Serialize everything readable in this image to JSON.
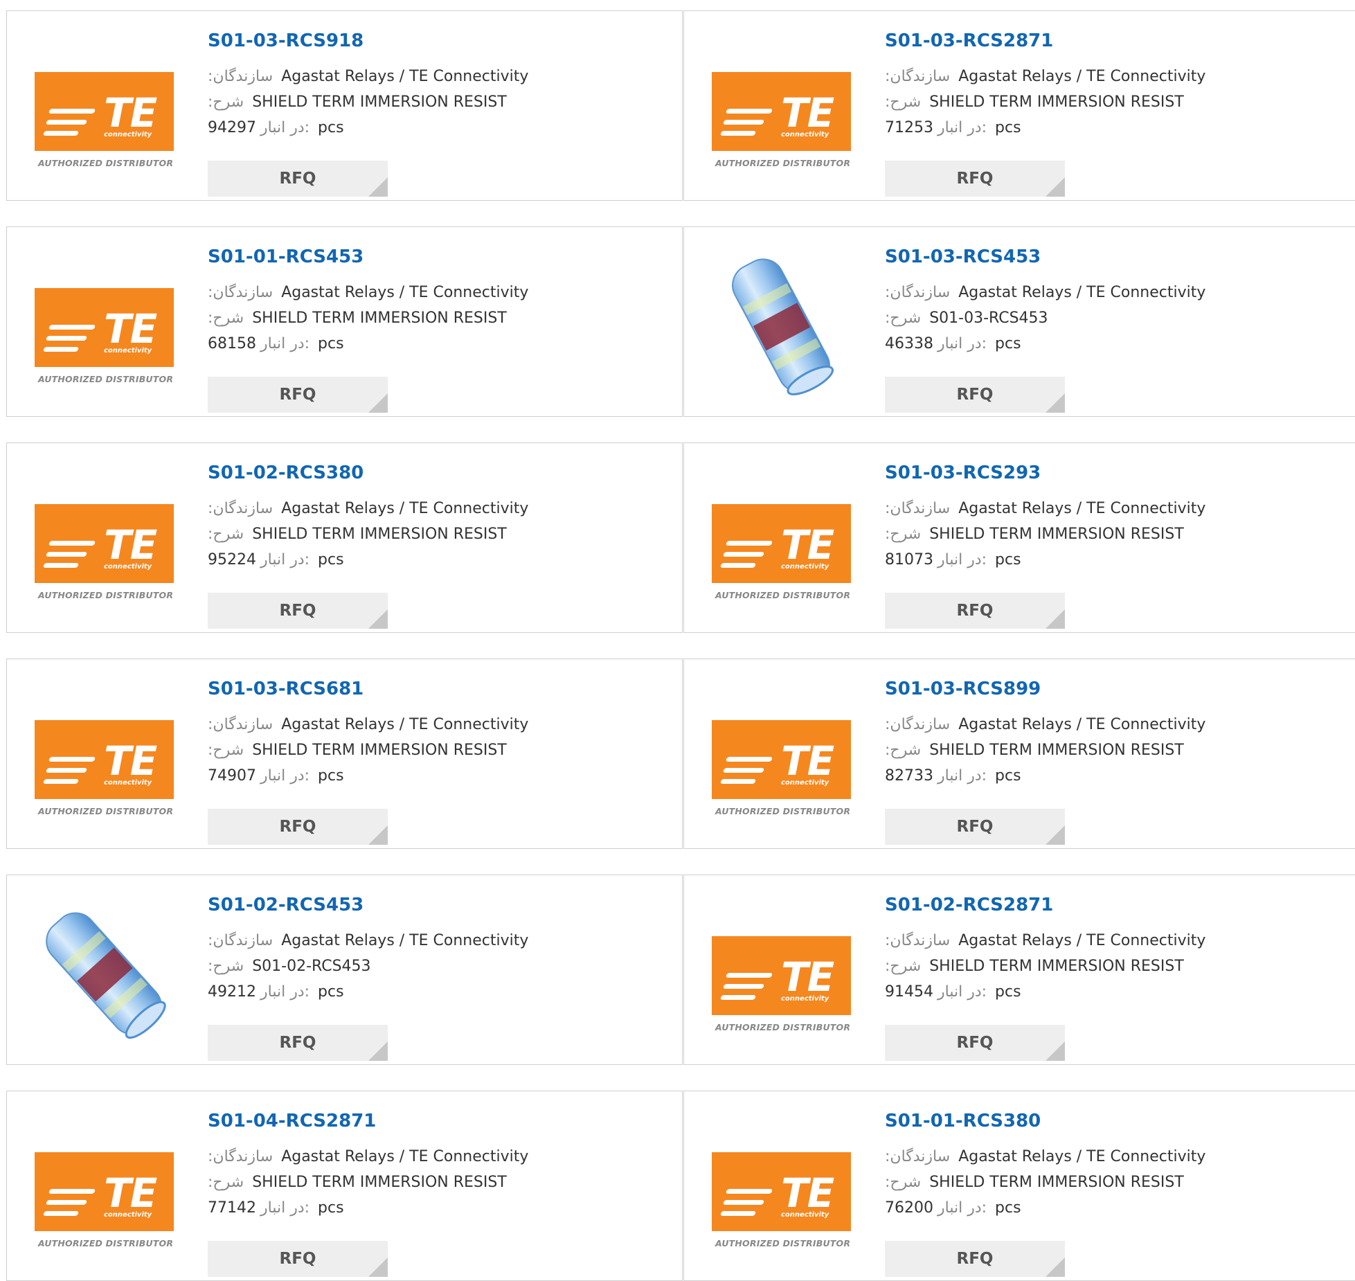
{
  "labels": {
    "manufacturer": ":سازندگان",
    "description": ":شرح",
    "stock": "در انبار:",
    "unit": "pcs",
    "rfq": "RFQ",
    "logo_brand": "TE",
    "logo_sub": "connectivity",
    "logo_caption": "AUTHORIZED DISTRIBUTOR"
  },
  "colors": {
    "brand_orange": "#f5871f",
    "link_blue": "#1166b3"
  },
  "products": [
    {
      "part": "S01-03-RCS918",
      "manufacturer": "Agastat Relays / TE Connectivity",
      "description": "SHIELD TERM IMMERSION RESIST",
      "stock": "94297",
      "image": "te-logo"
    },
    {
      "part": "S01-03-RCS2871",
      "manufacturer": "Agastat Relays / TE Connectivity",
      "description": "SHIELD TERM IMMERSION RESIST",
      "stock": "71253",
      "image": "te-logo"
    },
    {
      "part": "S01-01-RCS453",
      "manufacturer": "Agastat Relays / TE Connectivity",
      "description": "SHIELD TERM IMMERSION RESIST",
      "stock": "68158",
      "image": "te-logo"
    },
    {
      "part": "S01-03-RCS453",
      "manufacturer": "Agastat Relays / TE Connectivity",
      "description": "S01-03-RCS453",
      "stock": "46338",
      "image": "splice-photo"
    },
    {
      "part": "S01-02-RCS380",
      "manufacturer": "Agastat Relays / TE Connectivity",
      "description": "SHIELD TERM IMMERSION RESIST",
      "stock": "95224",
      "image": "te-logo"
    },
    {
      "part": "S01-03-RCS293",
      "manufacturer": "Agastat Relays / TE Connectivity",
      "description": "SHIELD TERM IMMERSION RESIST",
      "stock": "81073",
      "image": "te-logo"
    },
    {
      "part": "S01-03-RCS681",
      "manufacturer": "Agastat Relays / TE Connectivity",
      "description": "SHIELD TERM IMMERSION RESIST",
      "stock": "74907",
      "image": "te-logo"
    },
    {
      "part": "S01-03-RCS899",
      "manufacturer": "Agastat Relays / TE Connectivity",
      "description": "SHIELD TERM IMMERSION RESIST",
      "stock": "82733",
      "image": "te-logo"
    },
    {
      "part": "S01-02-RCS453",
      "manufacturer": "Agastat Relays / TE Connectivity",
      "description": "S01-02-RCS453",
      "stock": "49212",
      "image": "splice-photo-tilted"
    },
    {
      "part": "S01-02-RCS2871",
      "manufacturer": "Agastat Relays / TE Connectivity",
      "description": "SHIELD TERM IMMERSION RESIST",
      "stock": "91454",
      "image": "te-logo"
    },
    {
      "part": "S01-04-RCS2871",
      "manufacturer": "Agastat Relays / TE Connectivity",
      "description": "SHIELD TERM IMMERSION RESIST",
      "stock": "77142",
      "image": "te-logo"
    },
    {
      "part": "S01-01-RCS380",
      "manufacturer": "Agastat Relays / TE Connectivity",
      "description": "SHIELD TERM IMMERSION RESIST",
      "stock": "76200",
      "image": "te-logo"
    }
  ]
}
